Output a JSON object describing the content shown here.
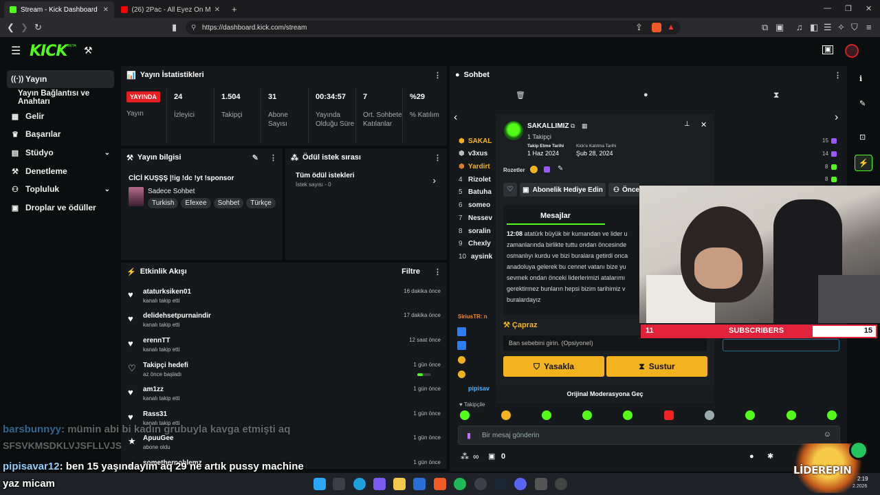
{
  "browser": {
    "tabs": [
      {
        "title": "Stream - Kick Dashboard",
        "active": true
      },
      {
        "title": "(26) 2Pac - All Eyez On Me - YouT",
        "active": false
      }
    ],
    "url": "https://dashboard.kick.com/stream"
  },
  "app": {
    "logo": "KICK",
    "beta": "BETA"
  },
  "sidebar": {
    "items": [
      {
        "label": "Yayın",
        "icon": "broadcast-icon",
        "active": true
      },
      {
        "label": "Yayın Bağlantısı ve Anahtarı",
        "icon": "",
        "active": false
      },
      {
        "label": "Gelir",
        "icon": "chart-icon"
      },
      {
        "label": "Başarılar",
        "icon": "trophy-icon"
      },
      {
        "label": "Stüdyo",
        "icon": "studio-icon",
        "chevron": true
      },
      {
        "label": "Denetleme",
        "icon": "hammer-icon"
      },
      {
        "label": "Topluluk",
        "icon": "community-icon",
        "chevron": true
      },
      {
        "label": "Droplar ve ödüller",
        "icon": "gift-icon"
      }
    ]
  },
  "stats": {
    "title": "Yayın İstatistikleri",
    "live_badge": "YAYINDA",
    "live_label": "Yayın",
    "items": [
      {
        "value": "24",
        "label": "İzleyici"
      },
      {
        "value": "1.504",
        "label": "Takipçi"
      },
      {
        "value": "31",
        "label": "Abone Sayısı"
      },
      {
        "value": "00:34:57",
        "label": "Yayında Olduğu Süre"
      },
      {
        "value": "7",
        "label": "Ort. Sohbete Katılanlar"
      },
      {
        "value": "%29",
        "label": "% Katılım"
      }
    ]
  },
  "stream_info": {
    "title": "Yayın bilgisi",
    "stream_title": "CİCİ KUŞŞŞ |!ig !dc !yt !sponsor",
    "category": "Sadece Sohbet",
    "tags": [
      "Turkish",
      "Efexee",
      "Sohbet",
      "Türkçe"
    ]
  },
  "rewards": {
    "title": "Ödül istek sırası",
    "item_title": "Tüm ödül istekleri",
    "item_sub": "İstek sayısı - 0"
  },
  "activity": {
    "title": "Etkinlik Akışı",
    "filter": "Filtre",
    "events": [
      {
        "name": "ataturksiken01",
        "sub": "kanalı takip etti",
        "time": "16 dakika önce"
      },
      {
        "name": "delidehsetpurnaindir",
        "sub": "kanalı takip etti",
        "time": "17 dakika önce"
      },
      {
        "name": "erennTT",
        "sub": "kanalı takip etti",
        "time": "12 saat önce"
      },
      {
        "name": "Takipçi hedefi",
        "sub": "az önce başladı",
        "time": "1 gün önce"
      },
      {
        "name": "am1zz",
        "sub": "kanalı takip etti",
        "time": "1 gün önce"
      },
      {
        "name": "Rass31",
        "sub": "kanalı takip etti",
        "time": "1 gün önce"
      },
      {
        "name": "ApuuGee",
        "sub": "abone oldu",
        "time": "1 gün önce"
      },
      {
        "name": "somethernoblemz",
        "sub": "",
        "time": "1 gün önce"
      }
    ]
  },
  "chat": {
    "title": "Sohbet",
    "leaderboard": [
      {
        "rank": "",
        "name": "SAKAL",
        "count": "15"
      },
      {
        "rank": "",
        "name": "v3xus",
        "count": "14"
      },
      {
        "rank": "",
        "name": "Yardirt",
        "count": "8"
      },
      {
        "rank": "4",
        "name": "Rizolet",
        "count": "8"
      },
      {
        "rank": "5",
        "name": "Batuha",
        "count": ""
      },
      {
        "rank": "6",
        "name": "someo",
        "count": ""
      },
      {
        "rank": "7",
        "name": "Nessev",
        "count": ""
      },
      {
        "rank": "8",
        "name": "soralin",
        "count": ""
      },
      {
        "rank": "9",
        "name": "Chexly",
        "count": ""
      },
      {
        "rank": "10",
        "name": "aysink",
        "count": ""
      }
    ],
    "users_below": [
      "SiriusTR: n",
      "pipisav"
    ],
    "followers_label": "Takipçile",
    "input_placeholder": "Bir mesaj gönderin",
    "viewer_count": "0"
  },
  "user_card": {
    "username": "SAKALLIMIZ",
    "followers": "1 Takipçi",
    "follow_date_label": "Takip Etme Tarihi",
    "follow_date": "1 Haz 2024",
    "join_date_label": "Kick'e Katılma Tarihi",
    "join_date": "Şub 28, 2024",
    "badges_label": "Rozetler",
    "gift_button": "Abonelik Hediye Edin",
    "prev_button": "Önce",
    "messages_tab": "Mesajlar",
    "message_time": "12:08",
    "message_text": "atatürk büyük bir kumandan ve lider u zamanlarında birlikte tuttu ondan öncesinde osmanlıyı kurdu ve bizi buralara getirdi onca anadoluya gelerek bu cennet vatanı bize yu sevmek ondan önceki liderlerimizi atalarımı gerektirmez bunların hepsi bizim tarihimiz v buralardayız",
    "ban_title": "Çapraz",
    "ban_placeholder": "Ban sebebini girin. (Opsiyonel)",
    "ban_button": "Yasakla",
    "timeout_button": "Sustur",
    "mod_link": "Orijinal Moderasyona Geç"
  },
  "overlay": {
    "sub_left": "11",
    "sub_label": "SUBSCRIBERS",
    "sub_right": "15",
    "chat1_user": "barsbunnyy",
    "chat1_text": ": mümin abi bi kadın grubuyla kavga etmişti aq",
    "chat2_text": "SFSVKMSDKLVJSFLLVJS",
    "chat3_user": "pipisavar12",
    "chat3_text": ": ben 15 yaşındayım aq 29 ne artık pussy machine",
    "chat4_text": "yaz micam",
    "brand": "LİDEREPIN",
    "clock_time": "2:19",
    "clock_date": "2.2026"
  },
  "colors": {
    "brand": "#53fc18",
    "live": "#e81e25",
    "ban": "#f3b31f"
  }
}
